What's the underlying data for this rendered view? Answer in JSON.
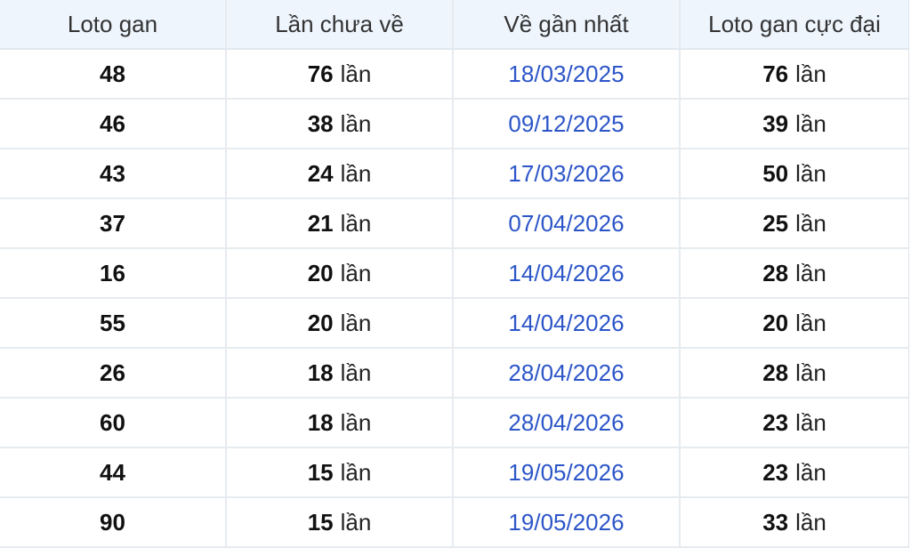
{
  "table": {
    "headers": [
      "Loto gan",
      "Lần chưa về",
      "Về gần nhất",
      "Loto gan cực đại"
    ],
    "unit": "lần",
    "rows": [
      {
        "loto": "48",
        "absent": "76",
        "last_seen": "18/03/2025",
        "max_gap": "76"
      },
      {
        "loto": "46",
        "absent": "38",
        "last_seen": "09/12/2025",
        "max_gap": "39"
      },
      {
        "loto": "43",
        "absent": "24",
        "last_seen": "17/03/2026",
        "max_gap": "50"
      },
      {
        "loto": "37",
        "absent": "21",
        "last_seen": "07/04/2026",
        "max_gap": "25"
      },
      {
        "loto": "16",
        "absent": "20",
        "last_seen": "14/04/2026",
        "max_gap": "28"
      },
      {
        "loto": "55",
        "absent": "20",
        "last_seen": "14/04/2026",
        "max_gap": "20"
      },
      {
        "loto": "26",
        "absent": "18",
        "last_seen": "28/04/2026",
        "max_gap": "28"
      },
      {
        "loto": "60",
        "absent": "18",
        "last_seen": "28/04/2026",
        "max_gap": "23"
      },
      {
        "loto": "44",
        "absent": "15",
        "last_seen": "19/05/2026",
        "max_gap": "23"
      },
      {
        "loto": "90",
        "absent": "15",
        "last_seen": "19/05/2026",
        "max_gap": "33"
      }
    ]
  },
  "colors": {
    "header_bg": "#eef5fd",
    "date_link": "#2c55c8",
    "grid_line": "#e6ebf0"
  }
}
